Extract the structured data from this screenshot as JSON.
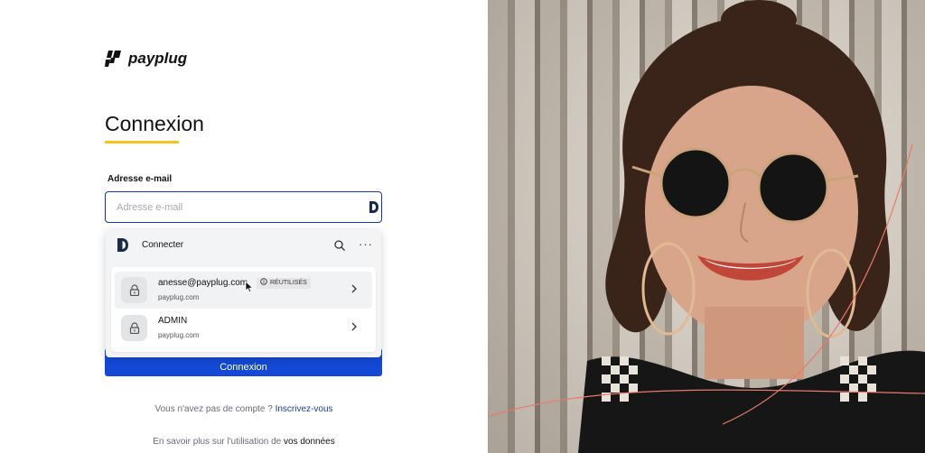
{
  "brand": {
    "name": "payplug",
    "accent": "#f5c518",
    "primary": "#1449d6"
  },
  "login": {
    "title": "Connexion",
    "email_label": "Adresse e-mail",
    "email_placeholder": "Adresse e-mail",
    "email_value": "",
    "submit_label": "Connexion",
    "signup_prefix": "Vous n'avez pas de compte ?",
    "signup_link": "Inscrivez-vous",
    "info_prefix": "En savoir plus sur l'utilisation de",
    "info_link": "vos données"
  },
  "autofill": {
    "header_label": "Connecter",
    "icons": [
      "dashlane-logo-icon",
      "search-icon",
      "more-icon"
    ],
    "credentials": [
      {
        "username": "anesse@payplug.com",
        "domain": "payplug.com",
        "badge": "RÉUTILISÉS",
        "badge_icon": "info-icon",
        "lock_icon": "lock-icon"
      },
      {
        "username": "ADMIN",
        "domain": "payplug.com",
        "lock_icon": "lock-icon"
      }
    ]
  }
}
